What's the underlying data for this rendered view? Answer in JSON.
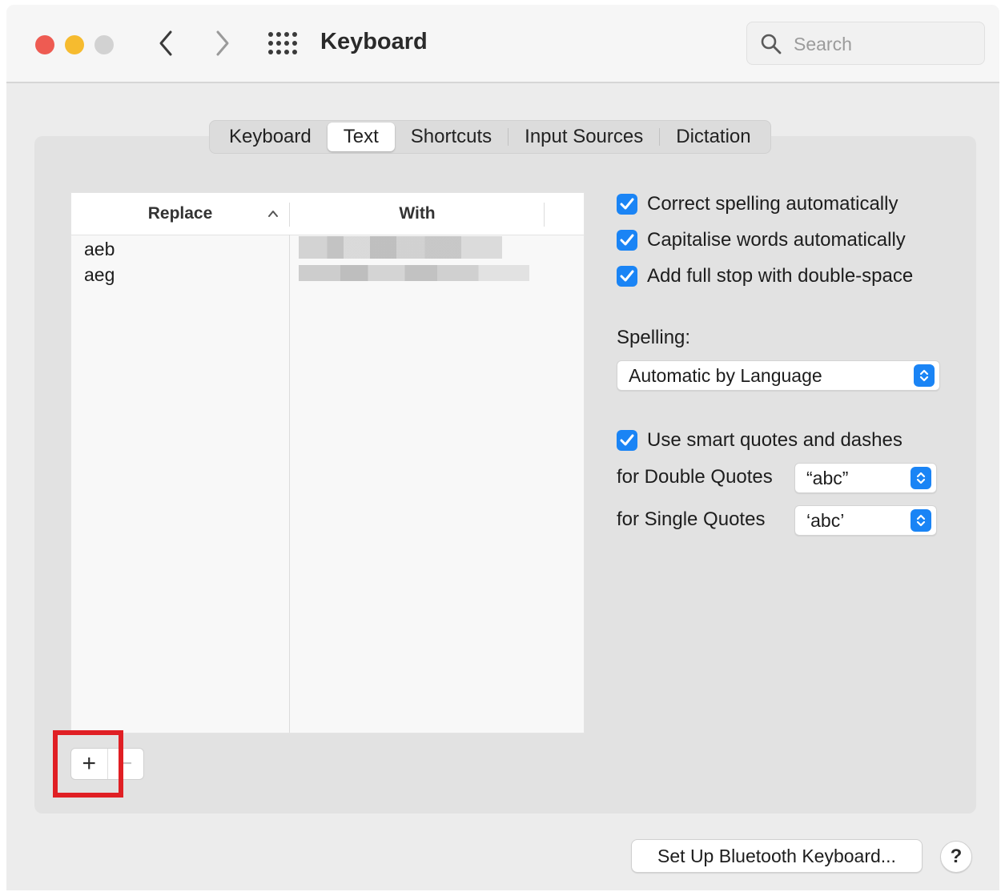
{
  "window": {
    "title": "Keyboard",
    "search_placeholder": "Search"
  },
  "tabs": [
    {
      "label": "Keyboard",
      "active": false
    },
    {
      "label": "Text",
      "active": true
    },
    {
      "label": "Shortcuts",
      "active": false
    },
    {
      "label": "Input Sources",
      "active": false
    },
    {
      "label": "Dictation",
      "active": false
    }
  ],
  "table": {
    "columns": [
      "Replace",
      "With"
    ],
    "rows": [
      {
        "replace": "aeb",
        "with": ""
      },
      {
        "replace": "aeg",
        "with": ""
      }
    ]
  },
  "buttons": {
    "add": "+",
    "remove": "−",
    "bluetooth": "Set Up Bluetooth Keyboard...",
    "help": "?"
  },
  "options": {
    "correct_spelling": {
      "label": "Correct spelling automatically",
      "checked": true
    },
    "capitalise_words": {
      "label": "Capitalise words automatically",
      "checked": true
    },
    "full_stop": {
      "label": "Add full stop with double-space",
      "checked": true
    },
    "smart_quotes": {
      "label": "Use smart quotes and dashes",
      "checked": true
    }
  },
  "spelling": {
    "label": "Spelling:",
    "value": "Automatic by Language"
  },
  "quotes": {
    "double_label": "for Double Quotes",
    "double_value": "“abc”",
    "single_label": "for Single Quotes",
    "single_value": "‘abc’"
  },
  "colors": {
    "accent": "#1a84f5",
    "highlight": "#e01f24",
    "close": "#ee5b52",
    "minimize": "#f6bb2f",
    "zoom": "#d2d2d2"
  }
}
